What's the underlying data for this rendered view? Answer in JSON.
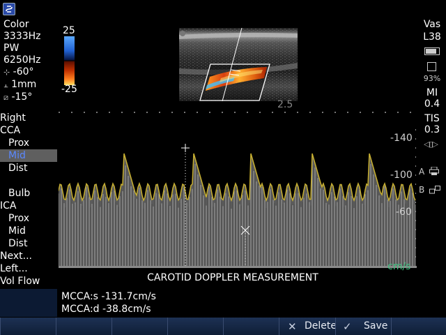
{
  "params": {
    "mode1": "Color",
    "freq1": "3333Hz",
    "mode2": "PW",
    "freq2": "6250Hz",
    "angle1": "-60°",
    "gate": "1mm",
    "angle2": "-15°"
  },
  "color_scale": {
    "top": "25",
    "bottom": "-25"
  },
  "probe": {
    "preset": "Vas",
    "transducer": "L38",
    "disk_percent": "93%",
    "mi_label": "MI",
    "mi_value": "0.4",
    "tis_label": "TIS",
    "tis_value": "0.3",
    "marker_a": "A",
    "marker_b": "B"
  },
  "image": {
    "depth": "2.5"
  },
  "nav": [
    {
      "label": "Right",
      "sub": false,
      "active": false
    },
    {
      "label": "CCA",
      "sub": false,
      "active": false
    },
    {
      "label": "Prox",
      "sub": true,
      "active": false
    },
    {
      "label": "Mid",
      "sub": true,
      "active": true
    },
    {
      "label": "Dist",
      "sub": true,
      "active": false
    },
    {
      "label": "",
      "sub": true,
      "active": false
    },
    {
      "label": "Bulb",
      "sub": true,
      "active": false
    },
    {
      "label": "ICA",
      "sub": false,
      "active": false
    },
    {
      "label": "Prox",
      "sub": true,
      "active": false
    },
    {
      "label": "Mid",
      "sub": true,
      "active": false
    },
    {
      "label": "Dist",
      "sub": true,
      "active": false
    },
    {
      "label": "Next...",
      "sub": false,
      "active": false
    },
    {
      "label": "Left...",
      "sub": false,
      "active": false
    },
    {
      "label": "Vol Flow",
      "sub": false,
      "active": false
    }
  ],
  "spectral": {
    "ticks": [
      "-140",
      "-100",
      "-60"
    ],
    "unit": "cm/s",
    "title": "CAROTID DOPPLER MEASUREMENT"
  },
  "measurements": {
    "line1": "MCCA:s -131.7cm/s",
    "line2": "MCCA:d -38.8cm/s"
  },
  "softkeys": {
    "delete": "Delete",
    "save": "Save"
  }
}
